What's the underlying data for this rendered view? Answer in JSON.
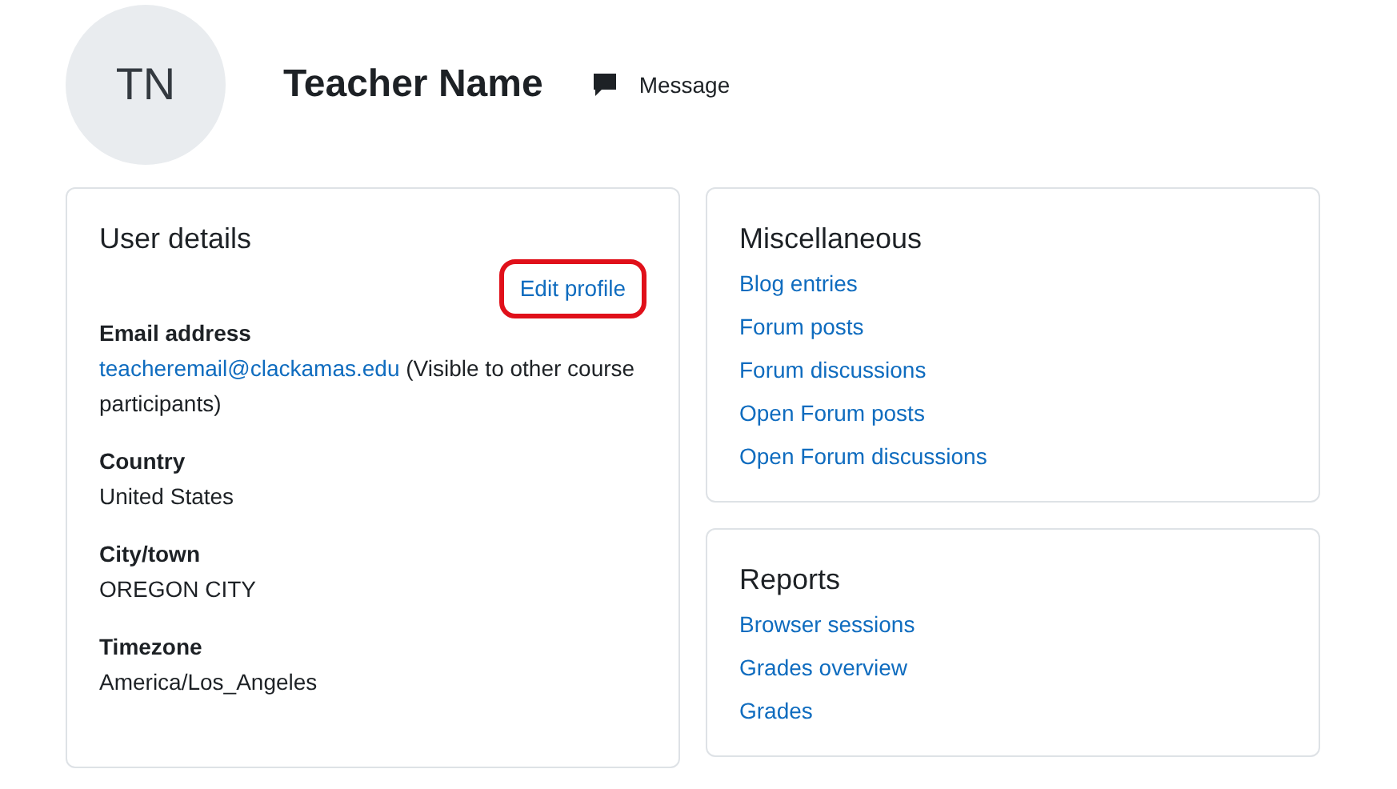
{
  "profile": {
    "initials": "TN",
    "name": "Teacher Name",
    "message_label": "Message"
  },
  "user_details": {
    "title": "User details",
    "edit_link": {
      "label": "Edit profile",
      "highlighted": true
    },
    "fields": [
      {
        "label": "Email address",
        "link": "teacheremail@clackamas.edu",
        "note": " (Visible to other course participants)"
      },
      {
        "label": "Country",
        "value": "United States"
      },
      {
        "label": "City/town",
        "value": "OREGON CITY"
      },
      {
        "label": "Timezone",
        "value": "America/Los_Angeles"
      }
    ]
  },
  "side_cards": [
    {
      "title": "Miscellaneous",
      "links": [
        "Blog entries",
        "Forum posts",
        "Forum discussions",
        "Open Forum posts",
        "Open Forum discussions"
      ]
    },
    {
      "title": "Reports",
      "links": [
        "Browser sessions",
        "Grades overview",
        "Grades"
      ]
    }
  ]
}
